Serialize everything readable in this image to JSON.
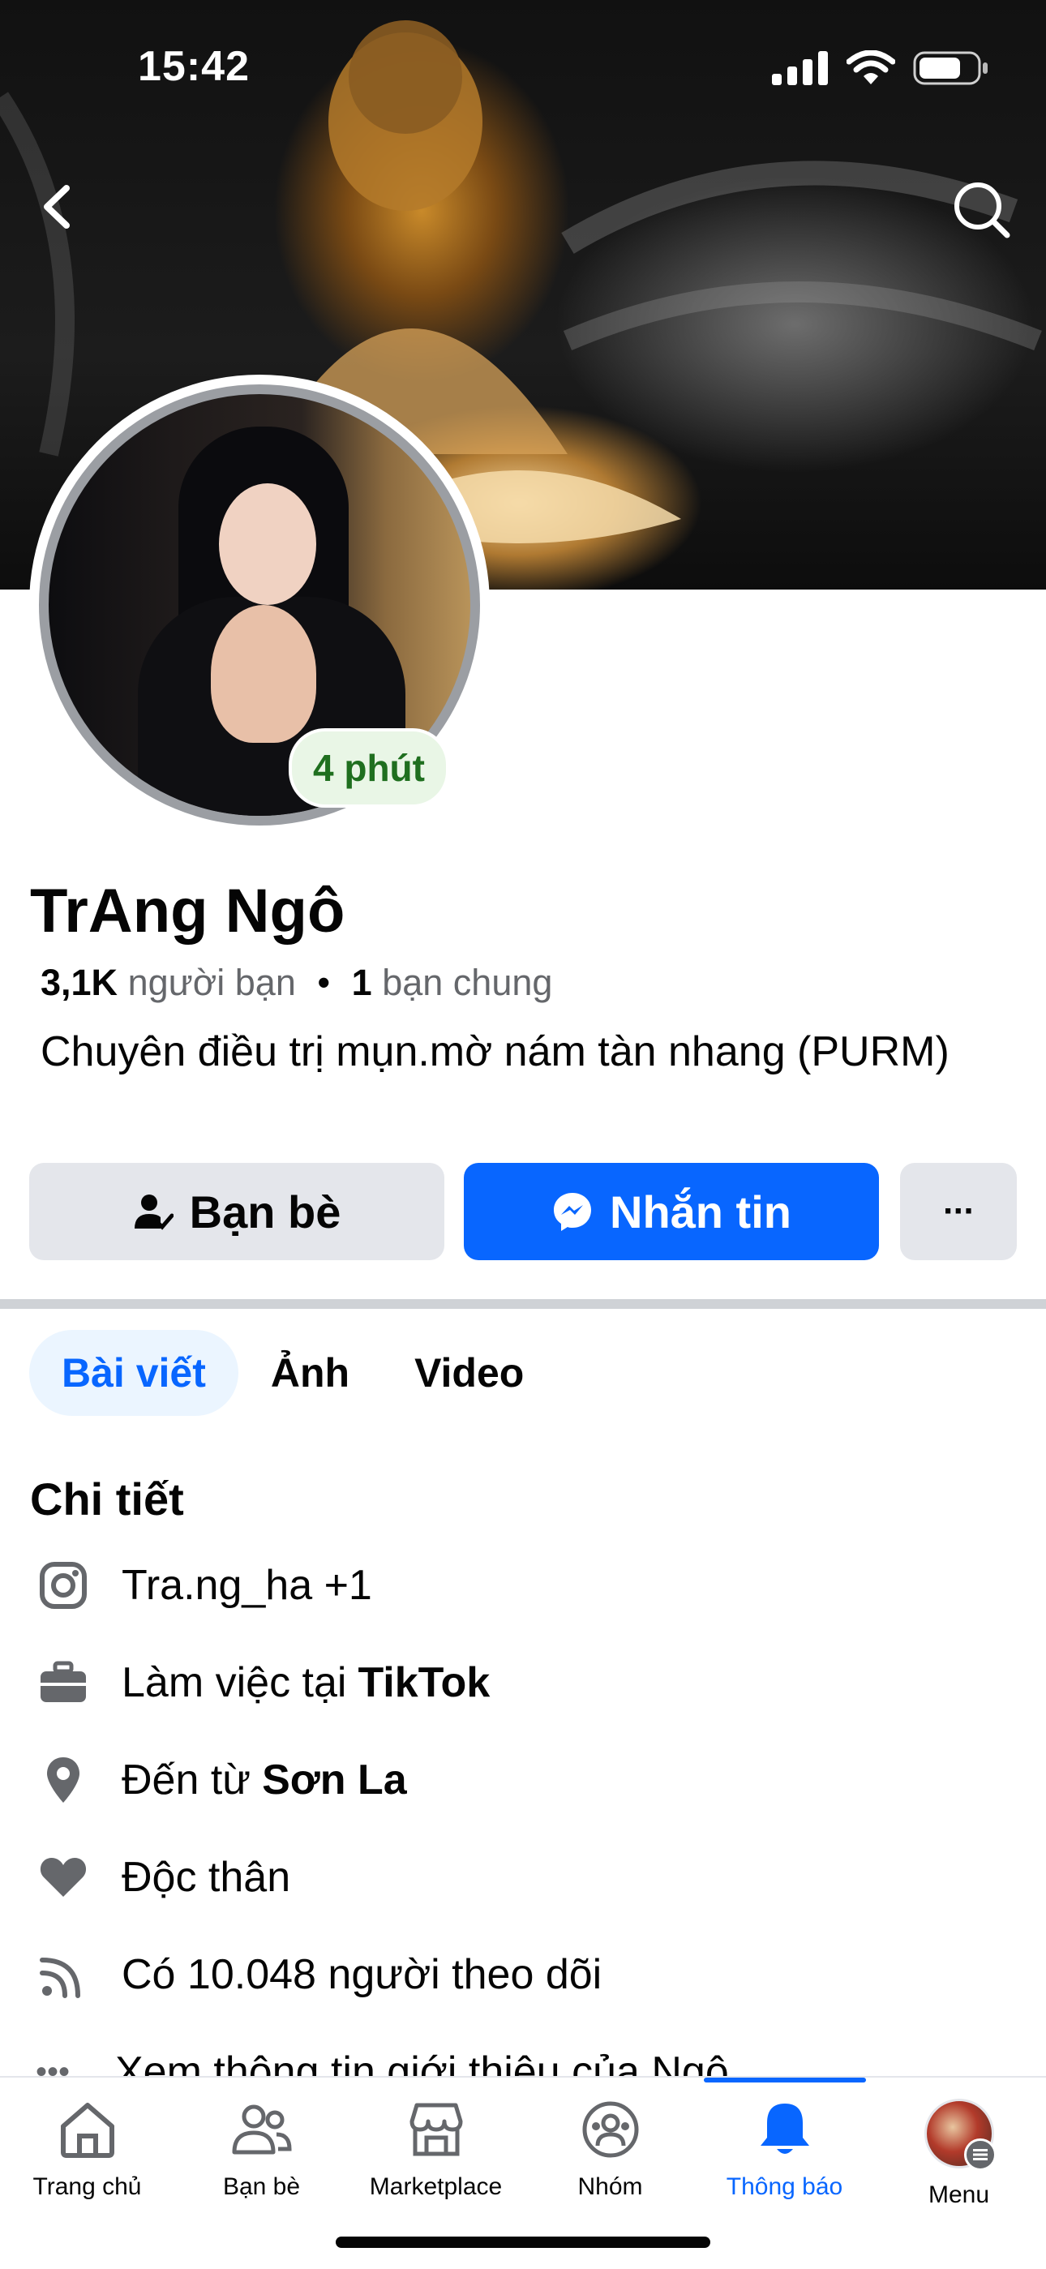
{
  "status_bar": {
    "time": "15:42"
  },
  "profile": {
    "name": "TrAng Ngô",
    "active_status": "4 phút",
    "friends_count": "3,1K",
    "friends_label": "người bạn",
    "mutual_count": "1",
    "mutual_label": "bạn chung",
    "bio": "Chuyên điều trị mụn.mờ nám tàn nhang (PURM)"
  },
  "actions": {
    "friends_label": "Bạn bè",
    "message_label": "Nhắn tin",
    "more_label": "···"
  },
  "tabs": [
    {
      "label": "Bài viết",
      "active": true
    },
    {
      "label": "Ảnh",
      "active": false
    },
    {
      "label": "Video",
      "active": false
    }
  ],
  "details": {
    "title": "Chi tiết",
    "instagram": "Tra.ng_ha +1",
    "work_prefix": "Làm việc tại",
    "work_place": "TikTok",
    "from_prefix": "Đến từ",
    "from_place": "Sơn La",
    "relationship": "Độc thân",
    "followers": "Có 10.048 người theo dõi",
    "see_more": "Xem thông tin giới thiệu của Ngô"
  },
  "bottom_nav": [
    {
      "label": "Trang chủ",
      "icon": "home-icon",
      "active": false
    },
    {
      "label": "Bạn bè",
      "icon": "friends-icon",
      "active": false
    },
    {
      "label": "Marketplace",
      "icon": "marketplace-icon",
      "active": false
    },
    {
      "label": "Nhóm",
      "icon": "groups-icon",
      "active": false
    },
    {
      "label": "Thông báo",
      "icon": "bell-icon",
      "active": true
    },
    {
      "label": "Menu",
      "icon": "menu-avatar",
      "active": false
    }
  ],
  "colors": {
    "accent": "#0866ff",
    "secondary_button": "#e4e6eb",
    "active_green": "#1f6f1f"
  }
}
